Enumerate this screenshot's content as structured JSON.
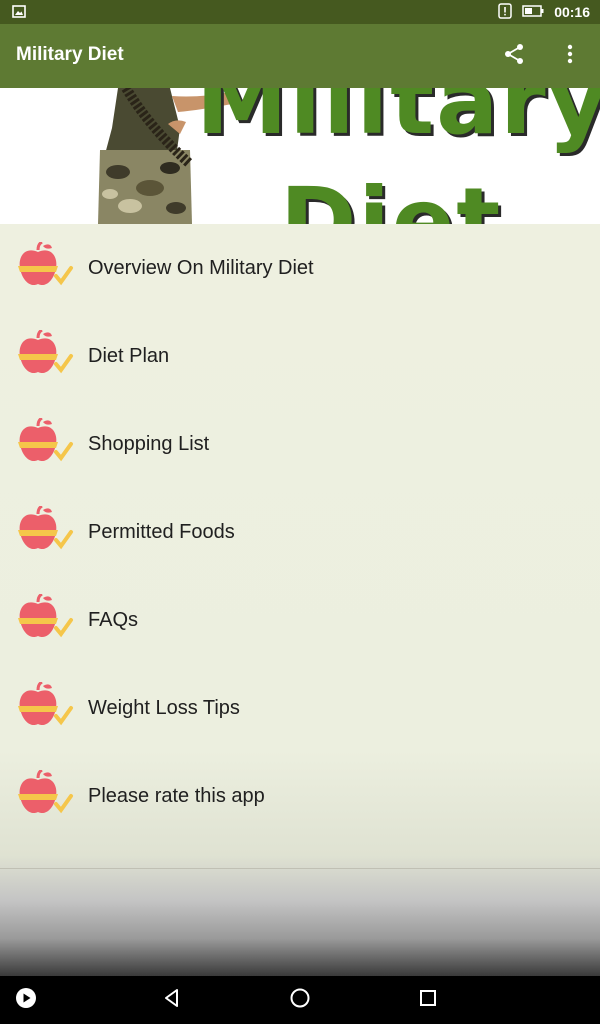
{
  "status_bar": {
    "time": "00:16"
  },
  "app_bar": {
    "title": "Military Diet",
    "share_icon": "share-icon",
    "more_icon": "more-vert-icon"
  },
  "banner": {
    "logo_text_line1": "Military",
    "logo_text_line2": "Diet"
  },
  "menu": {
    "items": [
      {
        "label": "Overview On Military Diet",
        "icon": "apple-diet-icon"
      },
      {
        "label": "Diet Plan",
        "icon": "apple-diet-icon"
      },
      {
        "label": "Shopping List",
        "icon": "apple-diet-icon"
      },
      {
        "label": "Permitted Foods",
        "icon": "apple-diet-icon"
      },
      {
        "label": "FAQs",
        "icon": "apple-diet-icon"
      },
      {
        "label": "Weight Loss Tips",
        "icon": "apple-diet-icon"
      },
      {
        "label": "Please rate this app",
        "icon": "apple-diet-icon"
      }
    ]
  },
  "colors": {
    "status_bar": "#45591f",
    "app_bar": "#5e7a33",
    "menu_bg": "#eef0e0",
    "apple": "#ec5f6a",
    "tape": "#f5c64a",
    "logo_green": "#4f8a23"
  }
}
